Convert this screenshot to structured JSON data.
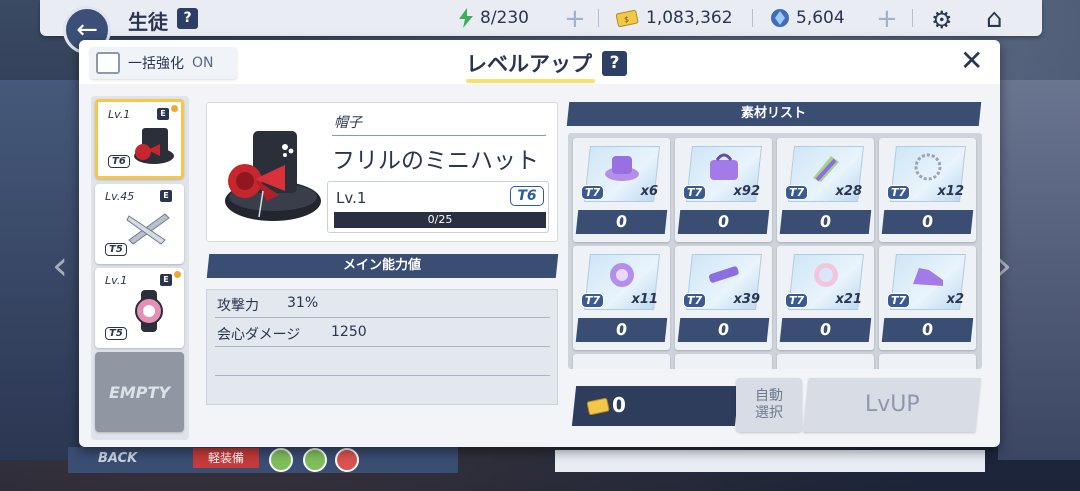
{
  "topbar": {
    "title": "生徒",
    "help": "?",
    "stamina": "8/230",
    "credits": "1,083,362",
    "gems": "5,604"
  },
  "modal": {
    "bulk_label": "一括強化",
    "bulk_state": "ON",
    "title": "レベルアップ",
    "help": "?",
    "close": "✕"
  },
  "slots": [
    {
      "lv": "Lv.1",
      "rarity": "E",
      "tier": "T6",
      "selected": true
    },
    {
      "lv": "Lv.45",
      "rarity": "E",
      "tier": "T5"
    },
    {
      "lv": "Lv.1",
      "rarity": "E",
      "tier": "T5"
    },
    {
      "label": "EMPTY"
    }
  ],
  "item": {
    "category": "帽子",
    "name": "フリルのミニハット",
    "level": "Lv.1",
    "tier": "T6",
    "xp": "0/25",
    "xp_fraction": 0
  },
  "stats": {
    "header": "メイン能力値",
    "rows": [
      {
        "key": "攻撃力",
        "value": "31%"
      },
      {
        "key": "会心ダメージ",
        "value": "1250"
      }
    ]
  },
  "materials": {
    "header": "素材リスト",
    "items": [
      {
        "tier": "T7",
        "count": "x6",
        "selected": "0",
        "icon": "purple-hat-icon"
      },
      {
        "tier": "T7",
        "count": "x92",
        "selected": "0",
        "icon": "purple-bag-icon"
      },
      {
        "tier": "T7",
        "count": "x28",
        "selected": "0",
        "icon": "gloves-icon"
      },
      {
        "tier": "T7",
        "count": "x12",
        "selected": "0",
        "icon": "bracelet-icon"
      },
      {
        "tier": "T7",
        "count": "x11",
        "selected": "0",
        "icon": "badge-icon"
      },
      {
        "tier": "T7",
        "count": "x39",
        "selected": "0",
        "icon": "hairpin-icon"
      },
      {
        "tier": "T7",
        "count": "x21",
        "selected": "0",
        "icon": "charm-icon"
      },
      {
        "tier": "T7",
        "count": "x2",
        "selected": "0",
        "icon": "shoes-icon"
      }
    ]
  },
  "footer": {
    "cost": "0",
    "auto_select": "自動\n選択",
    "auto_line1": "自動",
    "auto_line2": "選択",
    "lvup": "LvUP"
  },
  "background": {
    "back_label": "BACK",
    "tag": "軽装備"
  },
  "colors": {
    "accent": "#3a4d73",
    "underline": "#f3e36b",
    "tier_blue": "#2a5ca8"
  }
}
